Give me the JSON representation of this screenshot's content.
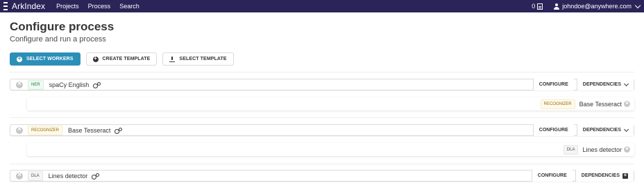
{
  "navbar": {
    "brand": "ArkIndex",
    "links": [
      "Projects",
      "Process",
      "Search"
    ],
    "counter": "0",
    "user_email": "johndoe@anywhere.com"
  },
  "page": {
    "title": "Configure process",
    "subtitle": "Configure and run a process"
  },
  "actions": {
    "select_workers": "SELECT WORKERS",
    "create_template": "CREATE TEMPLATE",
    "select_template": "SELECT TEMPLATE"
  },
  "workers": [
    {
      "type": "NER",
      "name": "spaCy English",
      "configure": "CONFIGURE",
      "dependencies": "DEPENDENCIES",
      "dependency": {
        "type": "RECOGNIZER",
        "name": "Base Tesseract"
      }
    },
    {
      "type": "RECOGNIZER",
      "name": "Base Tesseract",
      "configure": "CONFIGURE",
      "dependencies": "DEPENDENCIES",
      "dependency": {
        "type": "DLA",
        "name": "Lines detector"
      }
    },
    {
      "type": "DLA",
      "name": "Lines detector",
      "configure": "CONFIGURE",
      "dependencies": "DEPENDENCIES"
    }
  ],
  "colors": {
    "navbar": "#2b2458",
    "primary": "#2c8fb8"
  }
}
